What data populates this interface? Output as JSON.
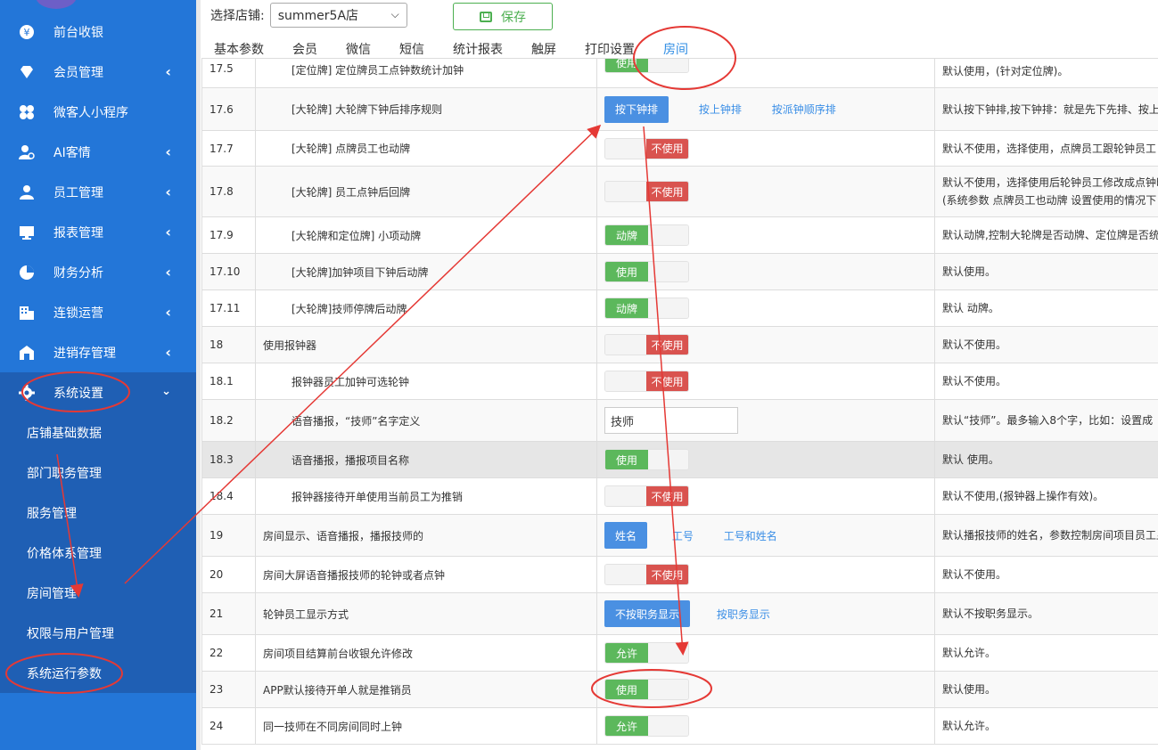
{
  "sidebar": {
    "items": [
      {
        "label": "前台收银",
        "icon": "yen-icon",
        "has_chevron": false
      },
      {
        "label": "会员管理",
        "icon": "diamond-icon",
        "has_chevron": true
      },
      {
        "label": "微客人小程序",
        "icon": "clover-icon",
        "has_chevron": false
      },
      {
        "label": "AI客情",
        "icon": "user-ai-icon",
        "has_chevron": true
      },
      {
        "label": "员工管理",
        "icon": "user-icon",
        "has_chevron": true
      },
      {
        "label": "报表管理",
        "icon": "monitor-icon",
        "has_chevron": true
      },
      {
        "label": "财务分析",
        "icon": "pie-chart-icon",
        "has_chevron": true
      },
      {
        "label": "连锁运营",
        "icon": "building-icon",
        "has_chevron": true
      },
      {
        "label": "进销存管理",
        "icon": "warehouse-icon",
        "has_chevron": true
      },
      {
        "label": "系统设置",
        "icon": "gear-icon",
        "has_chevron": true
      }
    ],
    "subitems": [
      {
        "label": "店铺基础数据"
      },
      {
        "label": "部门职务管理"
      },
      {
        "label": "服务管理"
      },
      {
        "label": "价格体系管理"
      },
      {
        "label": "房间管理"
      },
      {
        "label": "权限与用户管理"
      },
      {
        "label": "系统运行参数"
      }
    ]
  },
  "topbar": {
    "store_label": "选择店铺:",
    "store_value": "summer5A店",
    "save_label": "保存"
  },
  "tabs": [
    {
      "label": "基本参数"
    },
    {
      "label": "会员"
    },
    {
      "label": "微信"
    },
    {
      "label": "短信"
    },
    {
      "label": "统计报表"
    },
    {
      "label": "触屏"
    },
    {
      "label": "打印设置"
    },
    {
      "label": "房间"
    }
  ],
  "rows": [
    {
      "num": "17.5",
      "name": "[定位牌] 定位牌员工点钟数统计加钟",
      "desc": "默认使用，(针对定位牌)。"
    },
    {
      "num": "17.6",
      "name": "[大轮牌] 大轮牌下钟后排序规则",
      "desc": "默认按下钟排,按下钟排：就是先下先排、按上"
    },
    {
      "num": "17.7",
      "name": "[大轮牌] 点牌员工也动牌",
      "desc": "默认不使用，选择使用，点牌员工跟轮钟员工"
    },
    {
      "num": "17.8",
      "name": "[大轮牌] 员工点钟后回牌",
      "desc": "默认不使用，选择使用后轮钟员工修改成点钟时",
      "desc2": "(系统参数 点牌员工也动牌 设置使用的情况下"
    },
    {
      "num": "17.9",
      "name": "[大轮牌和定位牌] 小项动牌",
      "desc": "默认动牌,控制大轮牌是否动牌、定位牌是否统"
    },
    {
      "num": "17.10",
      "name": "[大轮牌]加钟项目下钟后动牌",
      "desc": "默认使用。"
    },
    {
      "num": "17.11",
      "name": "[大轮牌]技师停牌后动牌",
      "desc": "默认 动牌。"
    },
    {
      "num": "18",
      "name": "使用报钟器",
      "desc": "默认不使用。"
    },
    {
      "num": "18.1",
      "name": "报钟器员工加钟可选轮钟",
      "desc": "默认不使用。"
    },
    {
      "num": "18.2",
      "name": "语音播报，“技师”名字定义",
      "desc": "默认“技师”。最多输入8个字，比如：设置成"
    },
    {
      "num": "18.3",
      "name": "语音播报，播报项目名称",
      "desc": "默认 使用。"
    },
    {
      "num": "18.4",
      "name": "报钟器接待开单使用当前员工为推销",
      "desc": "默认不使用,(报钟器上操作有效)。"
    },
    {
      "num": "19",
      "name": "房间显示、语音播报，播报技师的",
      "desc": "默认播报技师的姓名，参数控制房间项目员工显"
    },
    {
      "num": "20",
      "name": "房间大屏语音播报技师的轮钟或者点钟",
      "desc": "默认不使用。"
    },
    {
      "num": "21",
      "name": "轮钟员工显示方式",
      "desc": "默认不按职务显示。"
    },
    {
      "num": "22",
      "name": "房间项目结算前台收银允许修改",
      "desc": "默认允许。"
    },
    {
      "num": "23",
      "name": "APP默认接待开单人就是推销员",
      "desc": "默认使用。"
    },
    {
      "num": "24",
      "name": "同一技师在不同房间同时上钟",
      "desc": "默认允许。"
    }
  ],
  "controls": {
    "r175_on": "使用",
    "r176_primary": "按下钟排",
    "r176_link1": "按上钟排",
    "r176_link2": "按派钟顺序排",
    "r177_off": "不使用",
    "r178_off": "不使用",
    "r179_on": "动牌",
    "r1710_on": "使用",
    "r1711_on": "动牌",
    "r18_off": "不使用",
    "r181_off": "不使用",
    "r182_input": "技师",
    "r183_on": "使用",
    "r184_off": "不使用",
    "r19_primary": "姓名",
    "r19_link1": "工号",
    "r19_link2": "工号和姓名",
    "r20_off": "不使用",
    "r21_primary": "不按职务显示",
    "r21_link1": "按职务显示",
    "r22_on": "允许",
    "r23_on": "使用",
    "r24_on": "允许"
  },
  "colors": {
    "sidebar_bg": "#2376d8",
    "sidebar_active": "#1f5fb4",
    "toggle_on": "#5cb85c",
    "toggle_off": "#d9534f",
    "primary_btn": "#4a90e2",
    "annotation_red": "#e53935"
  }
}
